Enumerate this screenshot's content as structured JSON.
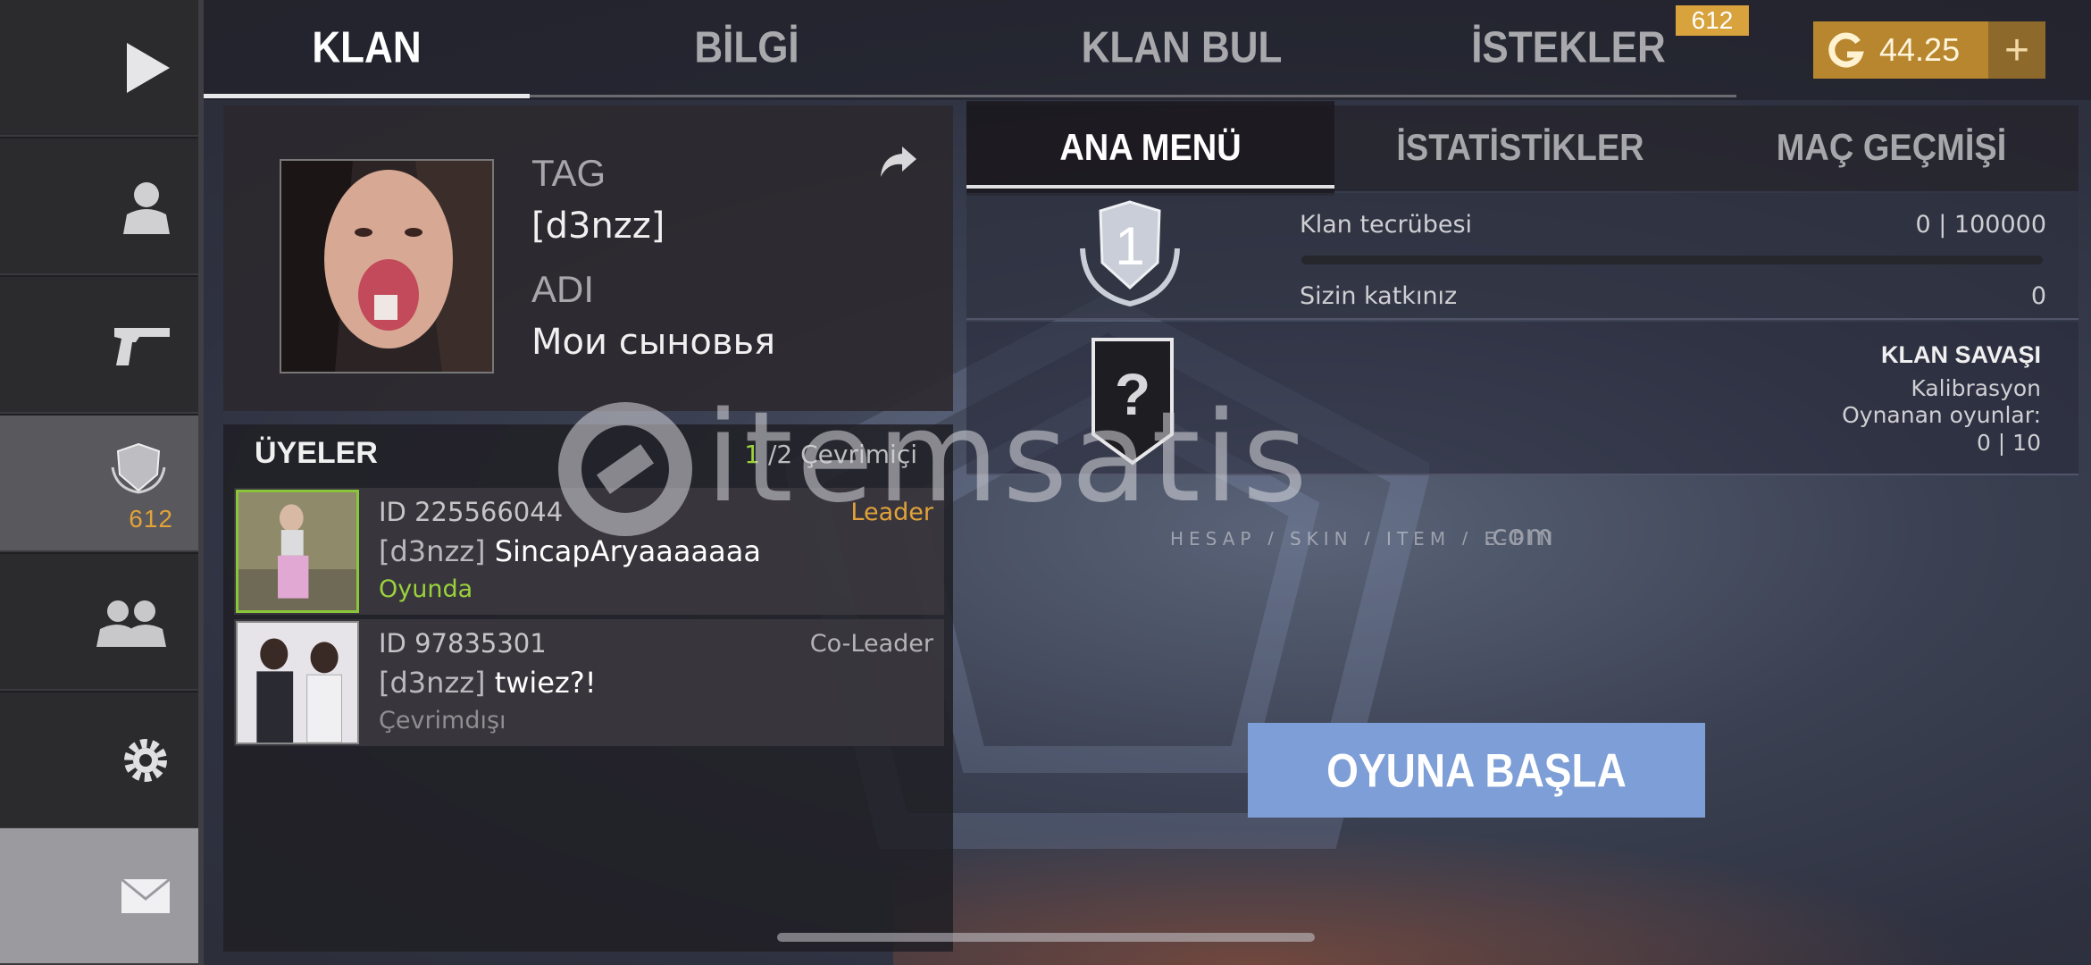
{
  "sidebar": {
    "items": [
      {
        "name": "play",
        "icon": "play-icon"
      },
      {
        "name": "profile",
        "icon": "person-icon"
      },
      {
        "name": "weapons",
        "icon": "pistol-icon"
      },
      {
        "name": "clan",
        "icon": "clan-shield-icon",
        "badge": "612"
      },
      {
        "name": "friends",
        "icon": "friends-icon"
      },
      {
        "name": "settings",
        "icon": "gear-icon"
      },
      {
        "name": "mail",
        "icon": "envelope-icon"
      }
    ]
  },
  "top_tabs": [
    {
      "label": "KLAN",
      "active": true
    },
    {
      "label": "BİLGİ",
      "active": false
    },
    {
      "label": "KLAN BUL",
      "active": false
    },
    {
      "label": "İSTEKLER",
      "active": false,
      "badge": "612"
    }
  ],
  "currency": {
    "value": "44.25",
    "plus": "+",
    "icon": "gold-g-icon"
  },
  "clan": {
    "tag_label": "TAG",
    "tag_value": "[d3nzz]",
    "name_label": "ADI",
    "name_value": "Мои сыновья"
  },
  "members": {
    "title": "ÜYELER",
    "online_count": "1",
    "online_rest": "/2 Çevrimiçi",
    "list": [
      {
        "id": "ID 225566044",
        "role": "Leader",
        "tag": "[d3nzz]",
        "name": "SincapAryaaaaaaa",
        "status": "Oyunda"
      },
      {
        "id": "ID 97835301",
        "role": "Co-Leader",
        "tag": "[d3nzz]",
        "name": "twiez?!",
        "status": "Çevrimdışı"
      }
    ]
  },
  "sub_tabs": [
    {
      "label": "ANA MENÜ",
      "active": true
    },
    {
      "label": "İSTATİSTİKLER",
      "active": false
    },
    {
      "label": "MAÇ GEÇMİŞİ",
      "active": false
    }
  ],
  "xp": {
    "rank": "1",
    "label": "Klan tecrübesi",
    "value": "0 | 100000",
    "progress": 0,
    "contribution_label": "Sizin katkınız",
    "contribution_value": "0"
  },
  "clan_war": {
    "badge": "?",
    "title": "KLAN SAVAŞI",
    "status": "Kalibrasyon",
    "played_label": "Oynanan oyunlar:",
    "played_value": "0 | 10"
  },
  "play_button": "OYUNA BAŞLA",
  "watermark": {
    "brand": "itemsatis",
    "tagline": "HESAP / SKIN / ITEM / E-PIN",
    "domain": ".com"
  },
  "colors": {
    "accent_gold": "#d8a23c",
    "online_green": "#9bd23c",
    "leader_orange": "#e2a23a",
    "play_button": "#7d9ed6"
  }
}
